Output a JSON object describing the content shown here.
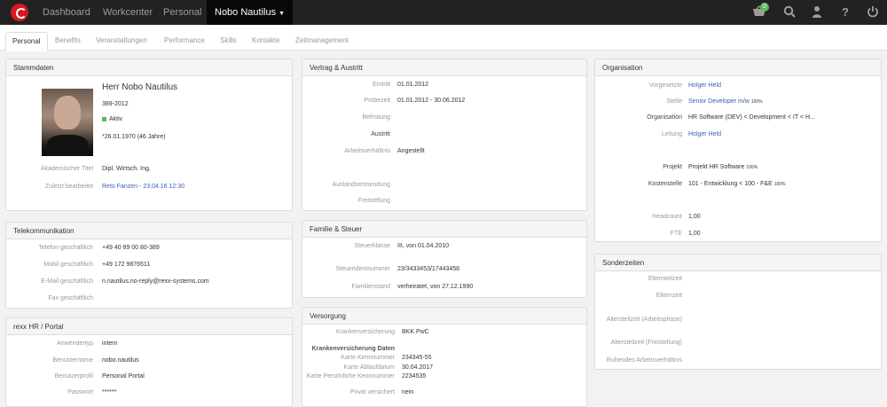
{
  "navbar": {
    "items": [
      {
        "label": "Dashboard"
      },
      {
        "label": "Workcenter"
      },
      {
        "label": "Personal"
      },
      {
        "label": "Nobo Nautilus"
      }
    ],
    "basket_count": "0"
  },
  "tabs": [
    {
      "label": "Personal"
    },
    {
      "label": "Benefits"
    },
    {
      "label": "Veranstaltungen"
    },
    {
      "label": "Performance"
    },
    {
      "label": "Skills"
    },
    {
      "label": "Kontakte"
    },
    {
      "label": "Zeitmanagement"
    }
  ],
  "stammdaten": {
    "title": "Stammdaten",
    "name": "Herr Nobo Nautilus",
    "personnel_number": "389-2012",
    "status": "Aktiv",
    "birth": "*26.01.1970 (46 Jahre)",
    "akad_label": "Akademischer Titel",
    "akad_value": "Dipl. Wirtsch. Ing.",
    "edited_label": "Zuletzt bearbeitet",
    "edited_value": "Reto Fanzen - 23.04.16 12:30"
  },
  "telekom": {
    "title": "Telekommunikation",
    "rows": [
      {
        "label": "Telefon geschäftlich",
        "value": "+49 40 89 00 80-389"
      },
      {
        "label": "Mobil geschäftlich",
        "value": "+49 172 9876511"
      },
      {
        "label": "E-Mail geschäftlich",
        "value": "n.nautilus.no-reply@rexx-systems.com"
      },
      {
        "label": "Fax geschäftlich",
        "value": ""
      }
    ]
  },
  "portal": {
    "title": "rexx HR / Portal",
    "rows": [
      {
        "label": "Anwendertyp",
        "value": "intern"
      },
      {
        "label": "Benutzername",
        "value": "nobo.nautilus"
      },
      {
        "label": "Benutzerprofil",
        "value": "Personal Portal"
      },
      {
        "label": "Passwort",
        "value": "******"
      }
    ]
  },
  "vertrag": {
    "title": "Vertrag & Austritt",
    "rows": [
      {
        "label": "Eintritt",
        "value": "01.01.2012"
      },
      {
        "label": "Probezeit",
        "value": "01.01.2012 - 30.06.2012"
      },
      {
        "label": "Befristung",
        "value": ""
      },
      {
        "label": "Austritt",
        "value": ""
      },
      {
        "label": "Arbeitsverhältnis",
        "value": "Angestellt"
      },
      {
        "label": "Auslandsentsendung",
        "value": ""
      },
      {
        "label": "Freistellung",
        "value": ""
      }
    ]
  },
  "familie": {
    "title": "Familie & Steuer",
    "rows": [
      {
        "label": "Steuerklasse",
        "value": "III, von 01.04.2010"
      },
      {
        "label": "Steueridentnummer",
        "value": "23/3433453/17443458"
      },
      {
        "label": "Familienstand",
        "value": "verheiratet, von 27.12.1990"
      }
    ]
  },
  "versorgung": {
    "title": "Versorgung",
    "kv_label": "Krankenversicherung",
    "kv_value": "BKK PwC",
    "subhead": "Krankenversicherung Daten",
    "rows": [
      {
        "label": "Karte Kennnummer",
        "value": "234345-55"
      },
      {
        "label": "Karte Ablaufdatum",
        "value": "30.04.2017"
      },
      {
        "label": "Karte Persönliche Kennnummer",
        "value": "2234535"
      }
    ],
    "privat_label": "Privat versichert",
    "privat_value": "nein"
  },
  "organisation": {
    "title": "Organisation",
    "vorgesetzte_label": "Vorgesetzte",
    "vorgesetzte_value": "Holger Held",
    "stelle_label": "Stelle",
    "stelle_value": "Senior Developer m/w",
    "stelle_pct": "100%",
    "org_label": "Organisation",
    "org_value": "HR Software (DEV) < Development < IT < H...",
    "leitung_label": "Leitung",
    "leitung_value": "Holger Held",
    "projekt_label": "Projekt",
    "projekt_value": "Projekt HR Software",
    "projekt_pct": "100%",
    "kst_label": "Kostenstelle",
    "kst_value": "101 - Entwicklung < 100 - F&E",
    "kst_pct": "100%",
    "headcount_label": "Headcount",
    "headcount_value": "1,00",
    "fte_label": "FTE",
    "fte_value": "1,00"
  },
  "sonderzeiten": {
    "title": "Sonderzeiten",
    "rows": [
      {
        "label": "Elternteilzeit"
      },
      {
        "label": "Elternzeit"
      },
      {
        "label": "Altersteilzeit (Arbeitsphase)"
      },
      {
        "label": "Altersteilzeit (Freistellung)"
      },
      {
        "label": "Ruhendes Arbeitsverhältnis"
      }
    ]
  }
}
